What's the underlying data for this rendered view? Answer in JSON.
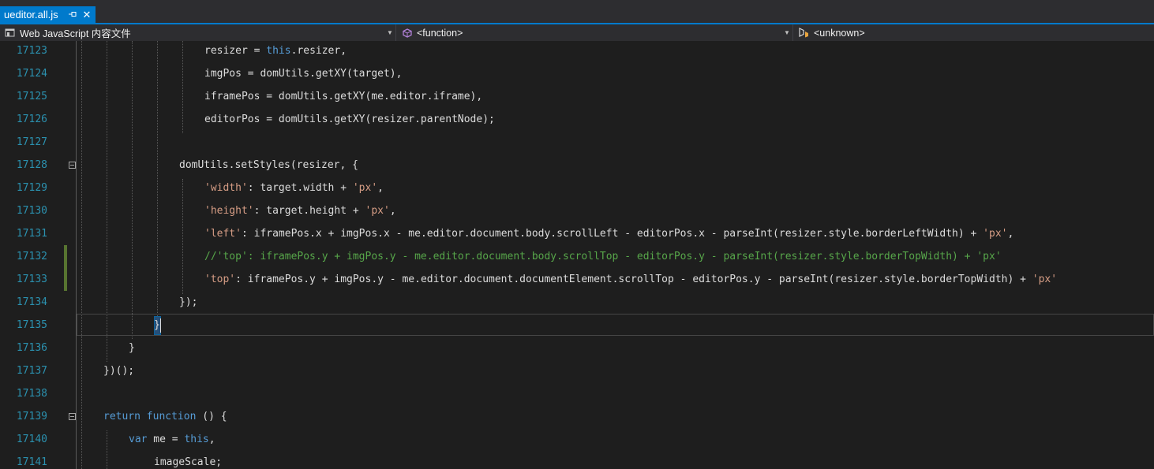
{
  "tab": {
    "title": "ueditor.all.js",
    "pin_icon": "pin-icon",
    "close_icon": "close-icon"
  },
  "nav": {
    "project": "Web JavaScript 内容文件",
    "scope": "<function>",
    "member": "<unknown>"
  },
  "colors": {
    "accent": "#007acc",
    "keyword": "#569cd6",
    "string": "#d69d85",
    "comment": "#57a64a",
    "line_number": "#2b91af"
  },
  "lines": [
    {
      "num": "17123",
      "parts": [
        [
          "",
          "resizer = "
        ],
        [
          "kw",
          "this"
        ],
        [
          "",
          ".resizer,"
        ]
      ]
    },
    {
      "num": "17124",
      "parts": [
        [
          "",
          "imgPos = domUtils.getXY(target),"
        ]
      ]
    },
    {
      "num": "17125",
      "parts": [
        [
          "",
          "iframePos = domUtils.getXY(me.editor.iframe),"
        ]
      ]
    },
    {
      "num": "17126",
      "parts": [
        [
          "",
          "editorPos = domUtils.getXY(resizer.parentNode);"
        ]
      ]
    },
    {
      "num": "17127",
      "parts": []
    },
    {
      "num": "17128",
      "parts": [
        [
          "",
          "domUtils.setStyles(resizer, {"
        ]
      ]
    },
    {
      "num": "17129",
      "parts": [
        [
          "str",
          "'width'"
        ],
        [
          "",
          ": target.width + "
        ],
        [
          "str",
          "'px'"
        ],
        [
          "",
          ","
        ]
      ]
    },
    {
      "num": "17130",
      "parts": [
        [
          "str",
          "'height'"
        ],
        [
          "",
          ": target.height + "
        ],
        [
          "str",
          "'px'"
        ],
        [
          "",
          ","
        ]
      ]
    },
    {
      "num": "17131",
      "parts": [
        [
          "str",
          "'left'"
        ],
        [
          "",
          ": iframePos.x + imgPos.x - me.editor.document.body.scrollLeft - editorPos.x - parseInt(resizer.style.borderLeftWidth) + "
        ],
        [
          "str",
          "'px'"
        ],
        [
          "",
          ","
        ]
      ]
    },
    {
      "num": "17132",
      "parts": [
        [
          "cmt",
          "//'top': iframePos.y + imgPos.y - me.editor.document.body.scrollTop - editorPos.y - parseInt(resizer.style.borderTopWidth) + 'px'"
        ]
      ]
    },
    {
      "num": "17133",
      "parts": [
        [
          "str",
          "'top'"
        ],
        [
          "",
          ": iframePos.y + imgPos.y - me.editor.document.documentElement.scrollTop - editorPos.y - parseInt(resizer.style.borderTopWidth) + "
        ],
        [
          "str",
          "'px'"
        ]
      ]
    },
    {
      "num": "17134",
      "parts": [
        [
          "",
          "});"
        ]
      ]
    },
    {
      "num": "17135",
      "parts": [
        [
          "",
          "}"
        ]
      ]
    },
    {
      "num": "17136",
      "parts": [
        [
          "",
          "}"
        ]
      ]
    },
    {
      "num": "17137",
      "parts": [
        [
          "",
          "})();"
        ]
      ]
    },
    {
      "num": "17138",
      "parts": []
    },
    {
      "num": "17139",
      "parts": [
        [
          "kw",
          "return"
        ],
        [
          "",
          " "
        ],
        [
          "kw",
          "function"
        ],
        [
          "",
          " () {"
        ]
      ]
    },
    {
      "num": "17140",
      "parts": [
        [
          "kw",
          "var"
        ],
        [
          "",
          " me = "
        ],
        [
          "kw",
          "this"
        ],
        [
          "",
          ","
        ]
      ]
    },
    {
      "num": "17141",
      "parts": [
        [
          "",
          "imageScale;"
        ]
      ]
    }
  ]
}
